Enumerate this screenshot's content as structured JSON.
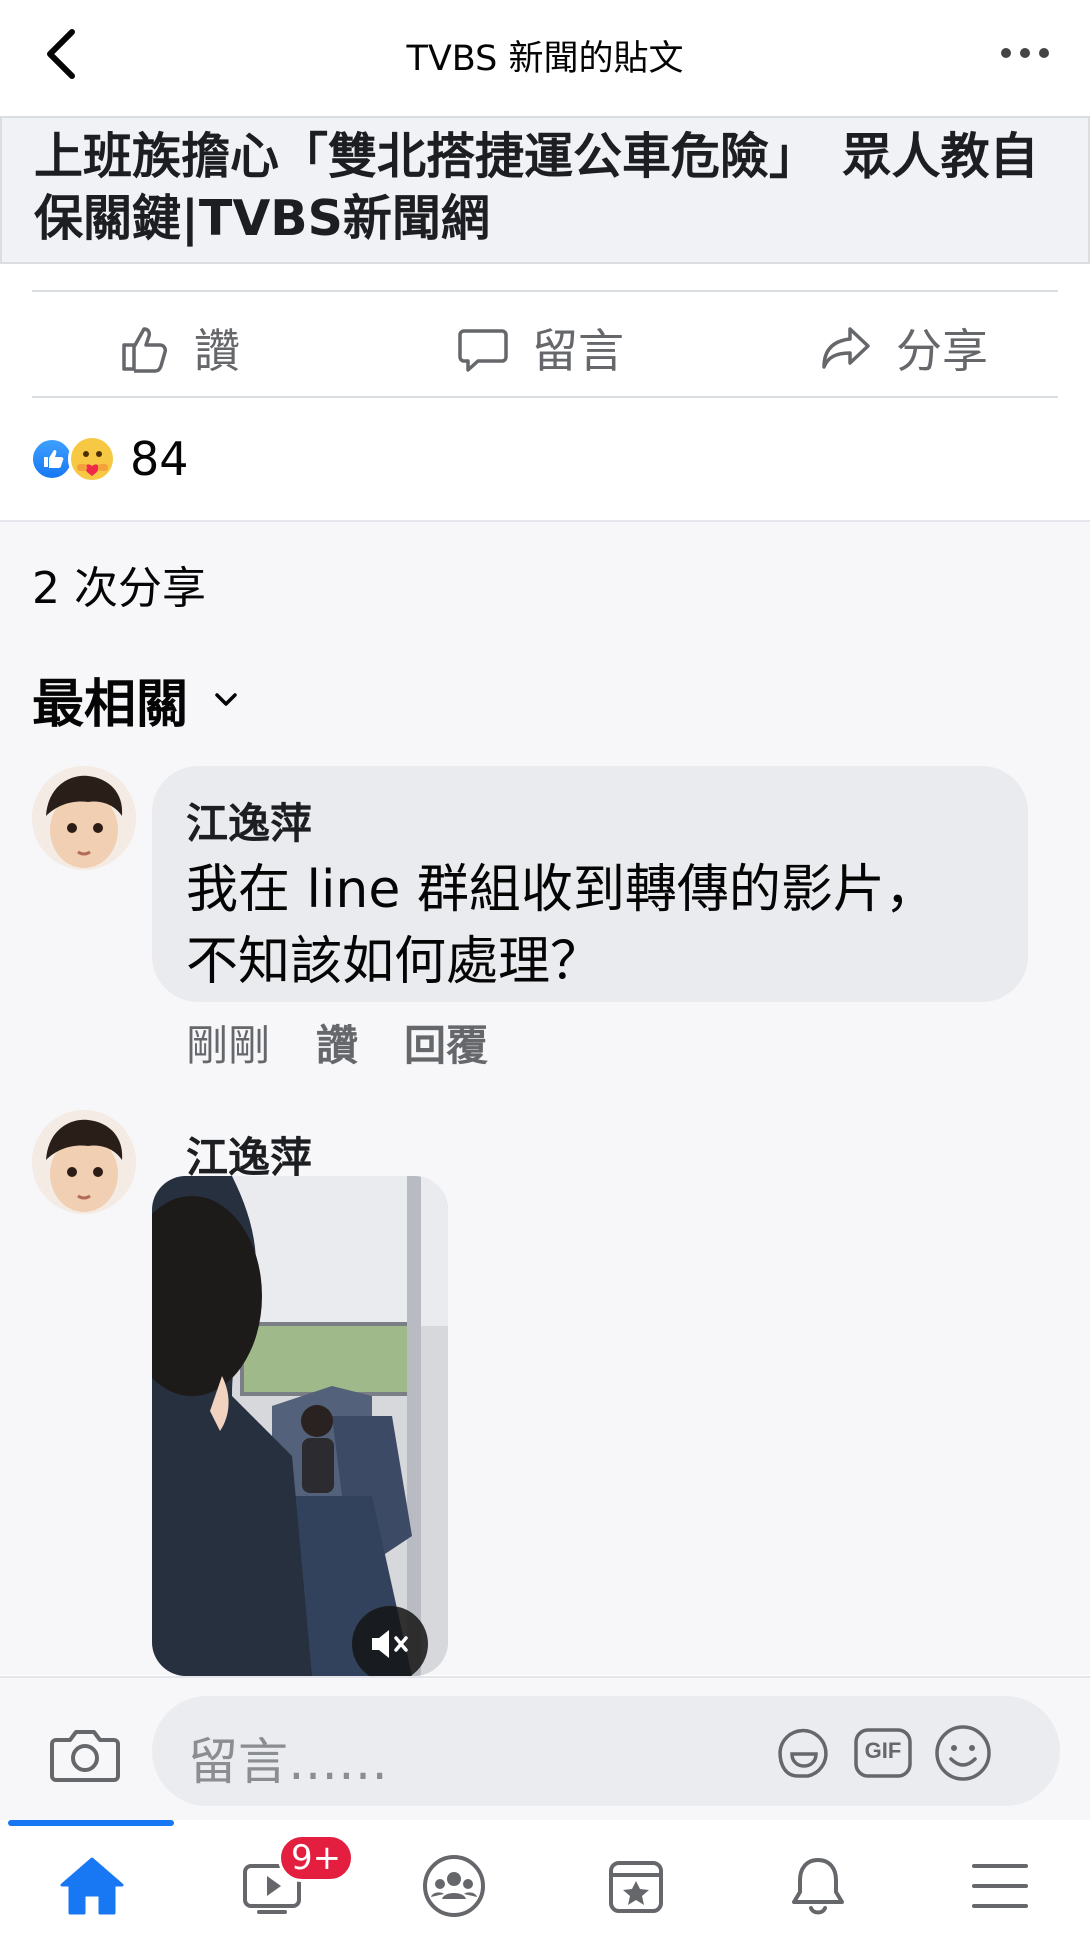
{
  "header": {
    "title": "TVBS 新聞的貼文",
    "back_icon": "chevron-left-icon",
    "more_icon": "more-horizontal-icon"
  },
  "link_preview": {
    "title": "上班族擔心「雙北搭捷運公車危險」　眾人教自保關鍵|TVBS新聞網"
  },
  "actions": {
    "like": "讚",
    "comment": "留言",
    "share": "分享"
  },
  "reactions": {
    "count": "84",
    "types": [
      "like",
      "care"
    ]
  },
  "shares": "2 次分享",
  "sort": {
    "label": "最相關"
  },
  "comments": [
    {
      "author": "江逸萍",
      "text_line1": "我在 line 群組收到轉傳的影片，",
      "text_line2": "不知該如何處理？",
      "time": "剛剛",
      "like": "讚",
      "reply": "回覆"
    },
    {
      "author": "江逸萍",
      "attachment": "video"
    }
  ],
  "composer": {
    "placeholder": "留言……",
    "gif_label": "GIF"
  },
  "bottom_nav": {
    "items": [
      "home-icon",
      "watch-icon",
      "groups-icon",
      "pages-icon",
      "notifications-icon",
      "menu-icon"
    ],
    "watch_badge": "9+",
    "active": "home-icon"
  },
  "colors": {
    "accent": "#1877f2",
    "badge": "#e41e3f",
    "secondary_text": "#65676b"
  }
}
